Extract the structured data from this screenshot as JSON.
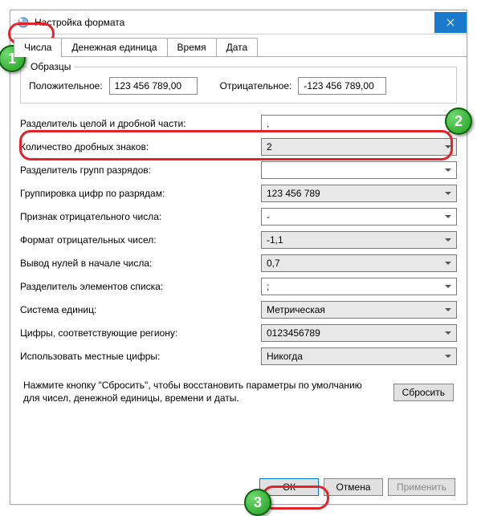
{
  "window": {
    "title": "Настройка формата"
  },
  "tabs": {
    "numbers": "Числа",
    "currency": "Денежная единица",
    "time": "Время",
    "date": "Дата"
  },
  "samples": {
    "legend": "Образцы",
    "positiveLabel": "Положительное:",
    "positiveValue": "123 456 789,00",
    "negativeLabel": "Отрицательное:",
    "negativeValue": "-123 456 789,00"
  },
  "settings": {
    "decimalSep": {
      "label": "Разделитель целой и дробной части:",
      "value": ","
    },
    "decimalDigits": {
      "label": "Количество дробных знаков:",
      "value": "2"
    },
    "groupSep": {
      "label": "Разделитель групп разрядов:",
      "value": ""
    },
    "grouping": {
      "label": "Группировка цифр по разрядам:",
      "value": "123 456 789"
    },
    "negSign": {
      "label": "Признак отрицательного числа:",
      "value": "-"
    },
    "negFormat": {
      "label": "Формат отрицательных чисел:",
      "value": "-1,1"
    },
    "leadingZero": {
      "label": "Вывод нулей в начале числа:",
      "value": "0,7"
    },
    "listSep": {
      "label": "Разделитель элементов списка:",
      "value": ";"
    },
    "measureSys": {
      "label": "Система единиц:",
      "value": "Метрическая"
    },
    "nativeDigits": {
      "label": "Цифры, соответствующие региону:",
      "value": "0123456789"
    },
    "useNative": {
      "label": "Использовать местные цифры:",
      "value": "Никогда"
    }
  },
  "reset": {
    "text": "Нажмите кнопку \"Сбросить\", чтобы восстановить параметры по умолчанию для чисел, денежной единицы, времени и даты.",
    "button": "Сбросить"
  },
  "footer": {
    "ok": "ОК",
    "cancel": "Отмена",
    "apply": "Применить"
  },
  "markers": {
    "m1": "1",
    "m2": "2",
    "m3": "3"
  }
}
